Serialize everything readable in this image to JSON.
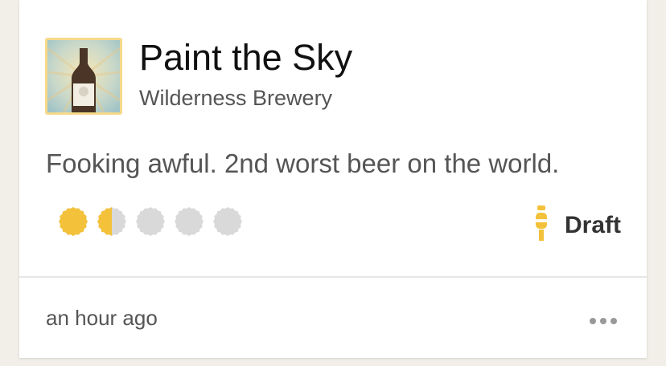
{
  "checkin": {
    "beer_name": "Paint the Sky",
    "brewery": "Wilderness Brewery",
    "comment": "Fooking awful. 2nd worst beer on the world.",
    "rating": 1.5,
    "rating_max": 5,
    "serving_label": "Draft",
    "serving_icon": "draft-tap-icon",
    "timestamp": "an hour ago",
    "more_icon": "more-dots-icon"
  },
  "colors": {
    "rating_filled": "#f3c13a",
    "rating_empty": "#d9d9d9",
    "serving_icon": "#f3c13a",
    "thumb_border": "#f6d98a"
  }
}
